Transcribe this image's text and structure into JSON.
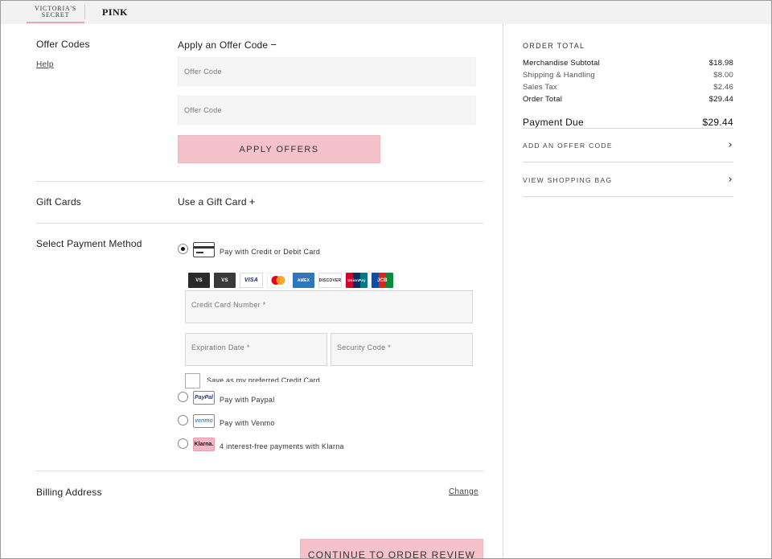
{
  "brand": {
    "victorias_secret_line1": "VICTORIA'S",
    "victorias_secret_line2": "SECRET",
    "pink": "PINK"
  },
  "offer_codes": {
    "label": "Offer Codes",
    "help": "Help",
    "title": "Apply an Offer Code",
    "toggle_glyph": "−",
    "input1_placeholder": "Offer Code",
    "input2_placeholder": "Offer Code",
    "apply_button": "APPLY OFFERS"
  },
  "gift_cards": {
    "label": "Gift Cards",
    "title": "Use a Gift Card",
    "toggle_glyph": "+"
  },
  "payment": {
    "label": "Select Payment Method",
    "credit_option": "Pay with Credit or Debit Card",
    "card_logos": [
      "VS",
      "VS",
      "VISA",
      "MC",
      "AMEX",
      "DISCOVER",
      "UnionPay",
      "JCB"
    ],
    "card_number_placeholder": "Credit Card Number *",
    "expiration_placeholder": "Expiration Date *",
    "security_placeholder": "Security Code *",
    "save_preferred": "Save as my preferred Credit Card",
    "paypal_logo": "PayPal",
    "paypal_option": "Pay with Paypal",
    "venmo_logo": "venmo",
    "venmo_option": "Pay with Venmo",
    "klarna_logo": "Klarna.",
    "klarna_option": "4 interest-free payments with Klarna"
  },
  "billing": {
    "label": "Billing Address",
    "change": "Change"
  },
  "continue_button": "CONTINUE TO ORDER REVIEW",
  "order_total": {
    "heading": "ORDER TOTAL",
    "rows": [
      {
        "label": "Merchandise Subtotal",
        "value": "$18.98"
      },
      {
        "label": "Shipping & Handling",
        "value": "$8.00"
      },
      {
        "label": "Sales Tax",
        "value": "$2.46"
      },
      {
        "label": "Order Total",
        "value": "$29.44"
      }
    ],
    "payment_due_label": "Payment Due",
    "payment_due_value": "$29.44",
    "add_offer_link": "ADD AN OFFER CODE",
    "view_bag_link": "VIEW SHOPPING BAG",
    "chevron": "›"
  },
  "colors": {
    "accent_pink": "#f5c2cb",
    "underline_pink": "#e8a6b4",
    "topbar_bg": "#f2f2f2"
  }
}
